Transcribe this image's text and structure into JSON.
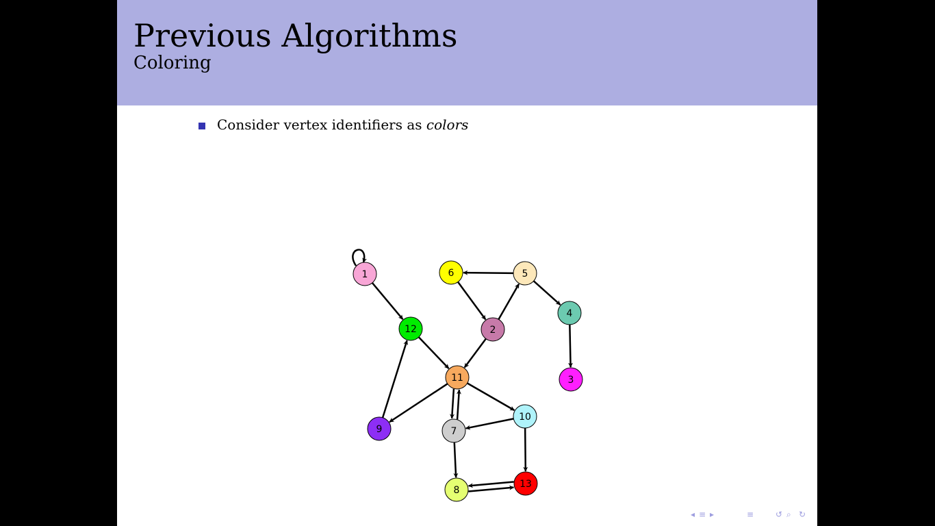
{
  "slide": {
    "title": "Previous Algorithms",
    "subtitle": "Coloring",
    "bullet": {
      "text": "Consider vertex identifiers as ",
      "emphasis": "colors"
    }
  },
  "graph": {
    "nodes": [
      {
        "id": "1",
        "color": "#f8a6d6"
      },
      {
        "id": "2",
        "color": "#c77aa9"
      },
      {
        "id": "3",
        "color": "#ff1fff"
      },
      {
        "id": "4",
        "color": "#6ccab0"
      },
      {
        "id": "5",
        "color": "#fde8ba"
      },
      {
        "id": "6",
        "color": "#ffff00"
      },
      {
        "id": "7",
        "color": "#cecece"
      },
      {
        "id": "8",
        "color": "#e5ff72"
      },
      {
        "id": "9",
        "color": "#8d2ef5"
      },
      {
        "id": "10",
        "color": "#aff3fa"
      },
      {
        "id": "11",
        "color": "#f7a95e"
      },
      {
        "id": "12",
        "color": "#00ec00"
      },
      {
        "id": "13",
        "color": "#ff0000"
      }
    ],
    "edges": [
      [
        "1",
        "1"
      ],
      [
        "1",
        "12"
      ],
      [
        "12",
        "11"
      ],
      [
        "9",
        "12"
      ],
      [
        "11",
        "9"
      ],
      [
        "11",
        "7"
      ],
      [
        "7",
        "11"
      ],
      [
        "11",
        "10"
      ],
      [
        "10",
        "7"
      ],
      [
        "10",
        "13"
      ],
      [
        "7",
        "8"
      ],
      [
        "8",
        "13"
      ],
      [
        "13",
        "8"
      ],
      [
        "2",
        "11"
      ],
      [
        "2",
        "5"
      ],
      [
        "6",
        "2"
      ],
      [
        "5",
        "6"
      ],
      [
        "5",
        "4"
      ],
      [
        "4",
        "3"
      ]
    ]
  },
  "navigation": {
    "icons": [
      "nav-left-arrow-icon",
      "nav-frame-icon",
      "nav-right-arrow-icon",
      "nav-section-icon",
      "nav-undo-icon",
      "nav-search-icon",
      "nav-redo-icon"
    ],
    "color": "#9d9ddf"
  }
}
